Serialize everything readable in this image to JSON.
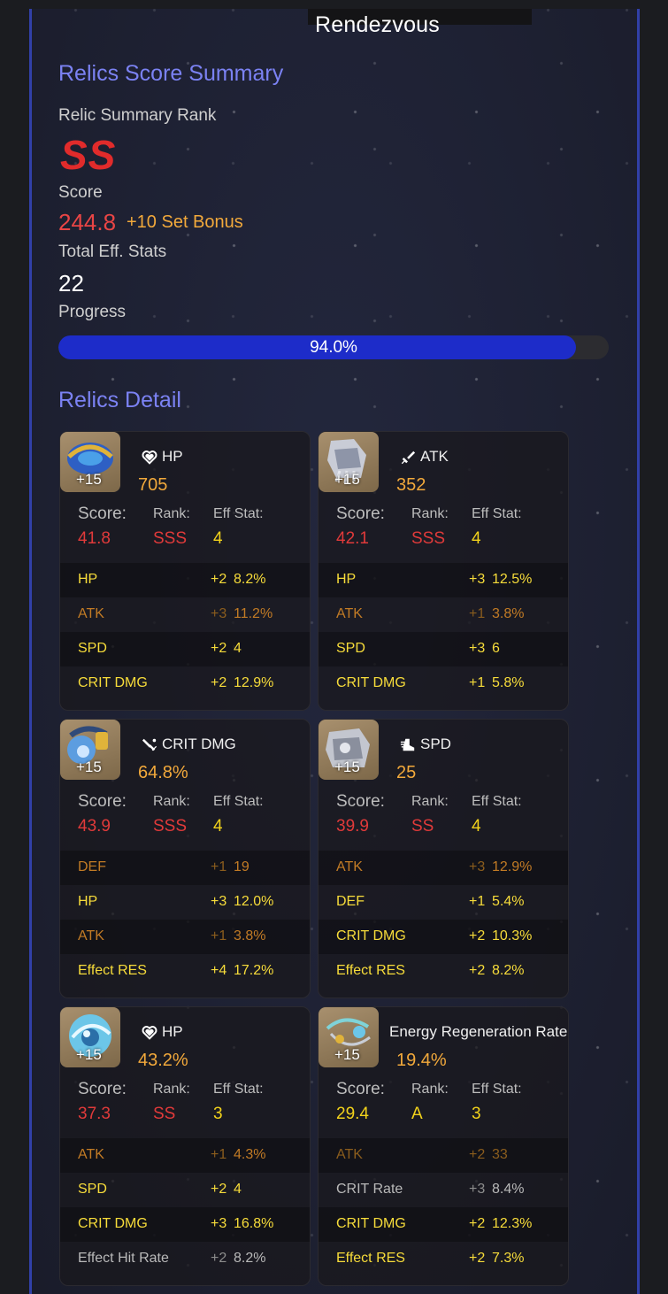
{
  "title": "Rendezvous",
  "summary": {
    "heading": "Relics Score Summary",
    "rank_label": "Relic Summary Rank",
    "rank": "SS",
    "score_label": "Score",
    "score": "244.8",
    "set_bonus": "+10 Set Bonus",
    "eff_label": "Total Eff. Stats",
    "eff_value": "22",
    "progress_label": "Progress",
    "progress_text": "94.0%",
    "progress_fraction": 0.94
  },
  "detail_heading": "Relics Detail",
  "labels": {
    "score": "Score:",
    "rank": "Rank:",
    "eff": "Eff Stat:"
  },
  "relics": [
    {
      "level": "+15",
      "icon": "heart-icon",
      "main_stat": "HP",
      "main_value": "705",
      "score": "41.8",
      "rank": "SSS",
      "eff": "4",
      "substats": [
        {
          "name": "HP",
          "rolls": "+2",
          "value": "8.2%",
          "style": "yellow"
        },
        {
          "name": "ATK",
          "rolls": "+3",
          "value": "11.2%",
          "style": "orange"
        },
        {
          "name": "SPD",
          "rolls": "+2",
          "value": "4",
          "style": "yellow"
        },
        {
          "name": "CRIT DMG",
          "rolls": "+2",
          "value": "12.9%",
          "style": "yellow"
        }
      ]
    },
    {
      "level": "+15",
      "icon": "sword-icon",
      "main_stat": "ATK",
      "main_value": "352",
      "score": "42.1",
      "rank": "SSS",
      "eff": "4",
      "substats": [
        {
          "name": "HP",
          "rolls": "+3",
          "value": "12.5%",
          "style": "yellow"
        },
        {
          "name": "ATK",
          "rolls": "+1",
          "value": "3.8%",
          "style": "orange"
        },
        {
          "name": "SPD",
          "rolls": "+3",
          "value": "6",
          "style": "yellow"
        },
        {
          "name": "CRIT DMG",
          "rolls": "+1",
          "value": "5.8%",
          "style": "yellow"
        }
      ]
    },
    {
      "level": "+15",
      "icon": "crit-dmg-icon",
      "main_stat": "CRIT DMG",
      "main_value": "64.8%",
      "score": "43.9",
      "rank": "SSS",
      "eff": "4",
      "substats": [
        {
          "name": "DEF",
          "rolls": "+1",
          "value": "19",
          "style": "orange"
        },
        {
          "name": "HP",
          "rolls": "+3",
          "value": "12.0%",
          "style": "yellow"
        },
        {
          "name": "ATK",
          "rolls": "+1",
          "value": "3.8%",
          "style": "orange"
        },
        {
          "name": "Effect RES",
          "rolls": "+4",
          "value": "17.2%",
          "style": "yellow"
        }
      ]
    },
    {
      "level": "+15",
      "icon": "boot-icon",
      "main_stat": "SPD",
      "main_value": "25",
      "score": "39.9",
      "rank": "SS",
      "eff": "4",
      "substats": [
        {
          "name": "ATK",
          "rolls": "+3",
          "value": "12.9%",
          "style": "orange"
        },
        {
          "name": "DEF",
          "rolls": "+1",
          "value": "5.4%",
          "style": "yellow"
        },
        {
          "name": "CRIT DMG",
          "rolls": "+2",
          "value": "10.3%",
          "style": "yellow"
        },
        {
          "name": "Effect RES",
          "rolls": "+2",
          "value": "8.2%",
          "style": "yellow"
        }
      ]
    },
    {
      "level": "+15",
      "icon": "heart-icon",
      "main_stat": "HP",
      "main_value": "43.2%",
      "score": "37.3",
      "rank": "SS",
      "eff": "3",
      "substats": [
        {
          "name": "ATK",
          "rolls": "+1",
          "value": "4.3%",
          "style": "orange"
        },
        {
          "name": "SPD",
          "rolls": "+2",
          "value": "4",
          "style": "yellow"
        },
        {
          "name": "CRIT DMG",
          "rolls": "+3",
          "value": "16.8%",
          "style": "yellow"
        },
        {
          "name": "Effect Hit Rate",
          "rolls": "+2",
          "value": "8.2%",
          "style": "grey"
        }
      ]
    },
    {
      "level": "+15",
      "icon": "",
      "main_stat": "Energy Regeneration Rate",
      "main_value": "19.4%",
      "score": "29.4",
      "rank": "A",
      "eff": "3",
      "substats": [
        {
          "name": "ATK",
          "rolls": "+2",
          "value": "33",
          "style": "dim"
        },
        {
          "name": "CRIT Rate",
          "rolls": "+3",
          "value": "8.4%",
          "style": "grey"
        },
        {
          "name": "CRIT DMG",
          "rolls": "+2",
          "value": "12.3%",
          "style": "yellow"
        },
        {
          "name": "Effect RES",
          "rolls": "+2",
          "value": "7.3%",
          "style": "yellow"
        }
      ]
    }
  ]
}
